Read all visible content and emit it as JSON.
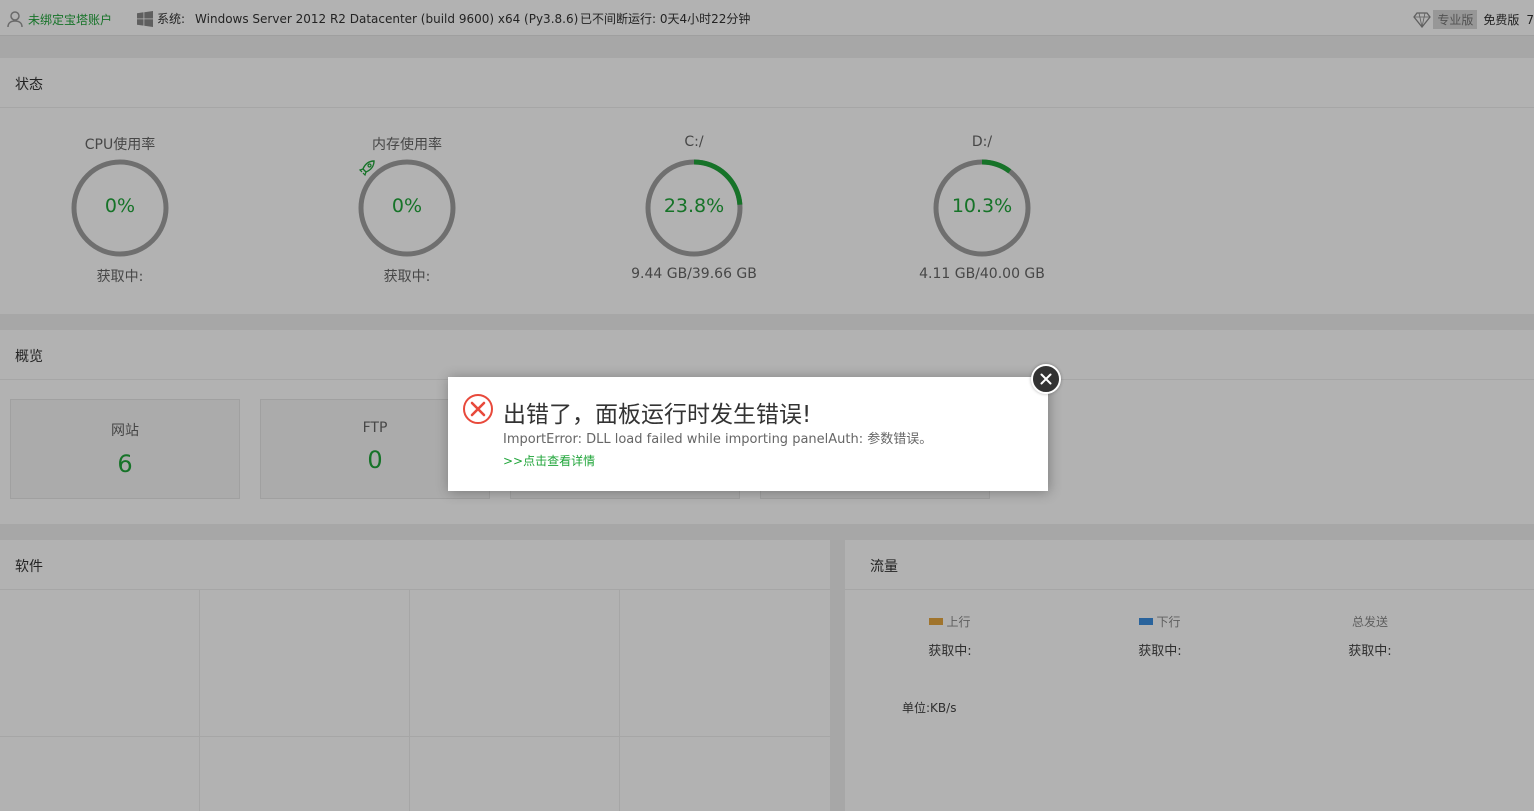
{
  "topbar": {
    "user_label": "未绑定宝塔账户",
    "system_label": "系统:",
    "system_value": "Windows Server 2012 R2 Datacenter (build 9600) x64 (Py3.8.6)",
    "uptime": "已不间断运行: 0天4小时22分钟",
    "pro_label": "专业版",
    "free_label": "免费版",
    "cut_text": "7"
  },
  "status": {
    "title": "状态",
    "gauges": [
      {
        "title": "CPU使用率",
        "value": "0%",
        "sub": "获取中:",
        "percent": 0
      },
      {
        "title": "内存使用率",
        "value": "0%",
        "sub": "获取中:",
        "percent": 0
      },
      {
        "title": "C:/",
        "value": "23.8%",
        "sub": "9.44 GB/39.66 GB",
        "percent": 23.8
      },
      {
        "title": "D:/",
        "value": "10.3%",
        "sub": "4.11 GB/40.00 GB",
        "percent": 10.3
      }
    ]
  },
  "overview": {
    "title": "概览",
    "cards": [
      {
        "label": "网站",
        "value": "6"
      },
      {
        "label": "FTP",
        "value": "0"
      }
    ]
  },
  "software": {
    "title": "软件"
  },
  "traffic": {
    "title": "流量",
    "columns": [
      {
        "label": "上行",
        "value": "获取中:",
        "color": "#e5a73f"
      },
      {
        "label": "下行",
        "value": "获取中:",
        "color": "#3b8fe0"
      },
      {
        "label": "总发送",
        "value": "获取中:"
      }
    ],
    "unit": "单位:KB/s"
  },
  "dialog": {
    "title": "出错了，面板运行时发生错误!",
    "message": "ImportError: DLL load failed while importing panelAuth: 参数错误。",
    "link": ">>点击查看详情"
  },
  "colors": {
    "accent": "#20a53a",
    "ring": "#a0a0a0",
    "error": "#e8493b"
  }
}
